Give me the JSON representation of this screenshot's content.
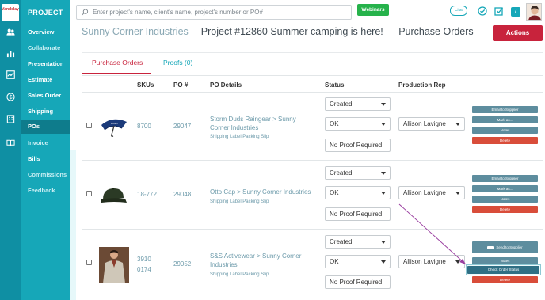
{
  "sidebar": {
    "logo_text": "Vandelay",
    "title": "PROJECT",
    "items": [
      {
        "label": "Overview",
        "dim": false
      },
      {
        "label": "Collaborate",
        "dim": true
      },
      {
        "label": "Presentation",
        "dim": false
      },
      {
        "label": "Estimate",
        "dim": false
      },
      {
        "label": "Sales Order",
        "dim": false
      },
      {
        "label": "Shipping",
        "dim": false
      },
      {
        "label": "POs",
        "dim": false,
        "active": true
      },
      {
        "label": "Invoice",
        "dim": true
      },
      {
        "label": "Bills",
        "dim": false
      },
      {
        "label": "Commissions",
        "dim": true
      },
      {
        "label": "Feedback",
        "dim": true
      }
    ]
  },
  "header": {
    "search_placeholder": "Enter project's name, client's name, project's number or PO#",
    "webinars_label": "Webinars",
    "chat_label": "Chat",
    "notification_count": "7"
  },
  "page": {
    "client_name": "Sunny Corner Industries",
    "title_rest": "— Project #12860 Summer camping is here! — Purchase Orders",
    "actions_label": "Actions"
  },
  "tabs": [
    {
      "label": "Purchase Orders",
      "active": true
    },
    {
      "label": "Proofs (0)",
      "active": false
    }
  ],
  "table": {
    "headers": {
      "skus": "SKUs",
      "po": "PO #",
      "details": "PO Details",
      "status": "Status",
      "rep": "Production Rep"
    },
    "rows": [
      {
        "sku": "8700",
        "po": "29047",
        "details": "Storm Duds Raingear > Sunny Corner Industries",
        "links": "Shipping Label|Packing Slip",
        "status1": "Created",
        "status2": "OK",
        "proof": "No Proof Required",
        "rep": "Allison Lavigne",
        "actions": [
          "Email to Supplier",
          "Mark as...",
          "Notes",
          "Delete"
        ]
      },
      {
        "sku": "18-772",
        "po": "29048",
        "details": "Otto Cap > Sunny Corner Industries",
        "links": "Shipping Label|Packing Slip",
        "status1": "Created",
        "status2": "OK",
        "proof": "No Proof Required",
        "rep": "Allison Lavigne",
        "actions": [
          "Email to Supplier",
          "Mark as...",
          "Notes",
          "Delete"
        ]
      },
      {
        "sku_line1": "3910",
        "sku_line2": "0174",
        "po": "29052",
        "details": "S&S Activewear > Sunny Corner Industries",
        "links": "Shipping Label|Packing Slip",
        "status1": "Created",
        "status2": "OK",
        "proof": "No Proof Required",
        "rep": "Allison Lavigne",
        "actions": [
          "Send to Supplier",
          "Notes",
          "Check Order Status",
          "Delete"
        ]
      }
    ]
  },
  "colors": {
    "sidebar": "#16a7b8",
    "accent_red": "#c8233c",
    "webinars_green": "#26b24b",
    "link_blue": "#6c9aaa"
  }
}
